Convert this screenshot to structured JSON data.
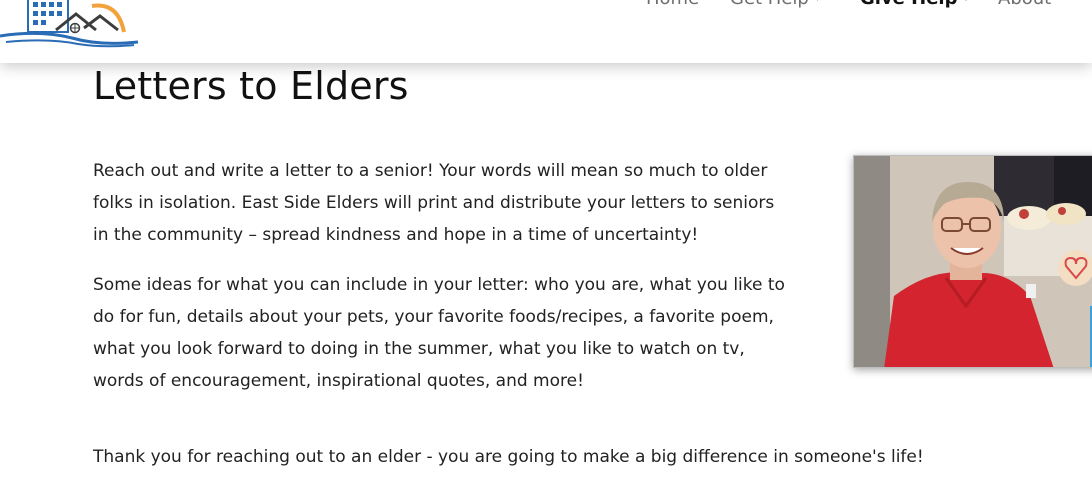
{
  "nav": {
    "items": [
      {
        "label": "Home"
      },
      {
        "label": "Get Help"
      },
      {
        "label": "Give Help"
      },
      {
        "label": "About"
      }
    ],
    "active": "Give Help"
  },
  "page": {
    "title": "Letters to Elders",
    "paragraphs": [
      "Reach out and write a letter to a senior!  Your words will mean so much to older folks in isolation.  East Side Elders will print and distribute your letters to seniors in the community – spread kindness and hope in a time of uncertainty!",
      "Some ideas for what you can include in your letter:  who you are, what you like to do for fun, details about your pets, your favorite foods/recipes, a favorite poem, what you look forward to doing in the summer, what you like to watch on tv, words of encouragement, inspirational quotes, and more!",
      "Thank you for reaching out to an elder - you are going to make a big difference in someone's life!"
    ]
  },
  "colors": {
    "logo_blue": "#2a6cb5",
    "logo_orange": "#f2a23a",
    "nav_text": "#6e6e6e",
    "shirt_red": "#d3242f"
  },
  "icons": {
    "logo": "house-buildings-logo",
    "caret": "chevron-down-icon"
  }
}
